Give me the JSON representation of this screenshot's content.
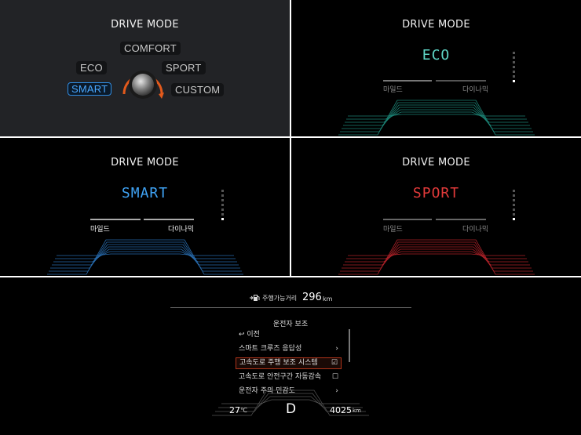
{
  "panels": {
    "selector": {
      "title": "DRIVE MODE",
      "modes": {
        "comfort": "COMFORT",
        "eco": "ECO",
        "sport": "SPORT",
        "smart": "SMART",
        "custom": "CUSTOM"
      },
      "selected": "SMART",
      "knob_icon": "rotary-knob-icon"
    },
    "eco": {
      "title": "DRIVE MODE",
      "mode": "ECO",
      "mode_color": "#5fd6c6",
      "label_left": "마일드",
      "label_right": "다이나믹",
      "level": 1
    },
    "smart": {
      "title": "DRIVE MODE",
      "mode": "SMART",
      "mode_color": "#3fa3f5",
      "label_left": "마일드",
      "label_right": "다이나믹",
      "level": 1
    },
    "sport": {
      "title": "DRIVE MODE",
      "mode": "SPORT",
      "mode_color": "#e23a3a",
      "label_left": "마일드",
      "label_right": "다이나믹",
      "level": 1
    }
  },
  "cluster": {
    "range_label": "주행가능거리",
    "range_value": "296",
    "range_unit": "km",
    "fuel_icon": "fuel-pump-icon",
    "menu_title": "운전자 보조",
    "menu_items": [
      {
        "label": "이전",
        "icon": "back-arrow-icon",
        "end": ""
      },
      {
        "label": "스마트 크루즈 응답성",
        "end": "›"
      },
      {
        "label": "고속도로 주행 보조 시스템",
        "end": "☑"
      },
      {
        "label": "고속도로 안전구간 자동감속",
        "end": "☐"
      },
      {
        "label": "운전자 주의 민감도",
        "end": "›"
      }
    ],
    "temperature": "27",
    "temperature_unit": "℃",
    "gear": "D",
    "odometer": "4025",
    "odometer_unit": "km"
  }
}
